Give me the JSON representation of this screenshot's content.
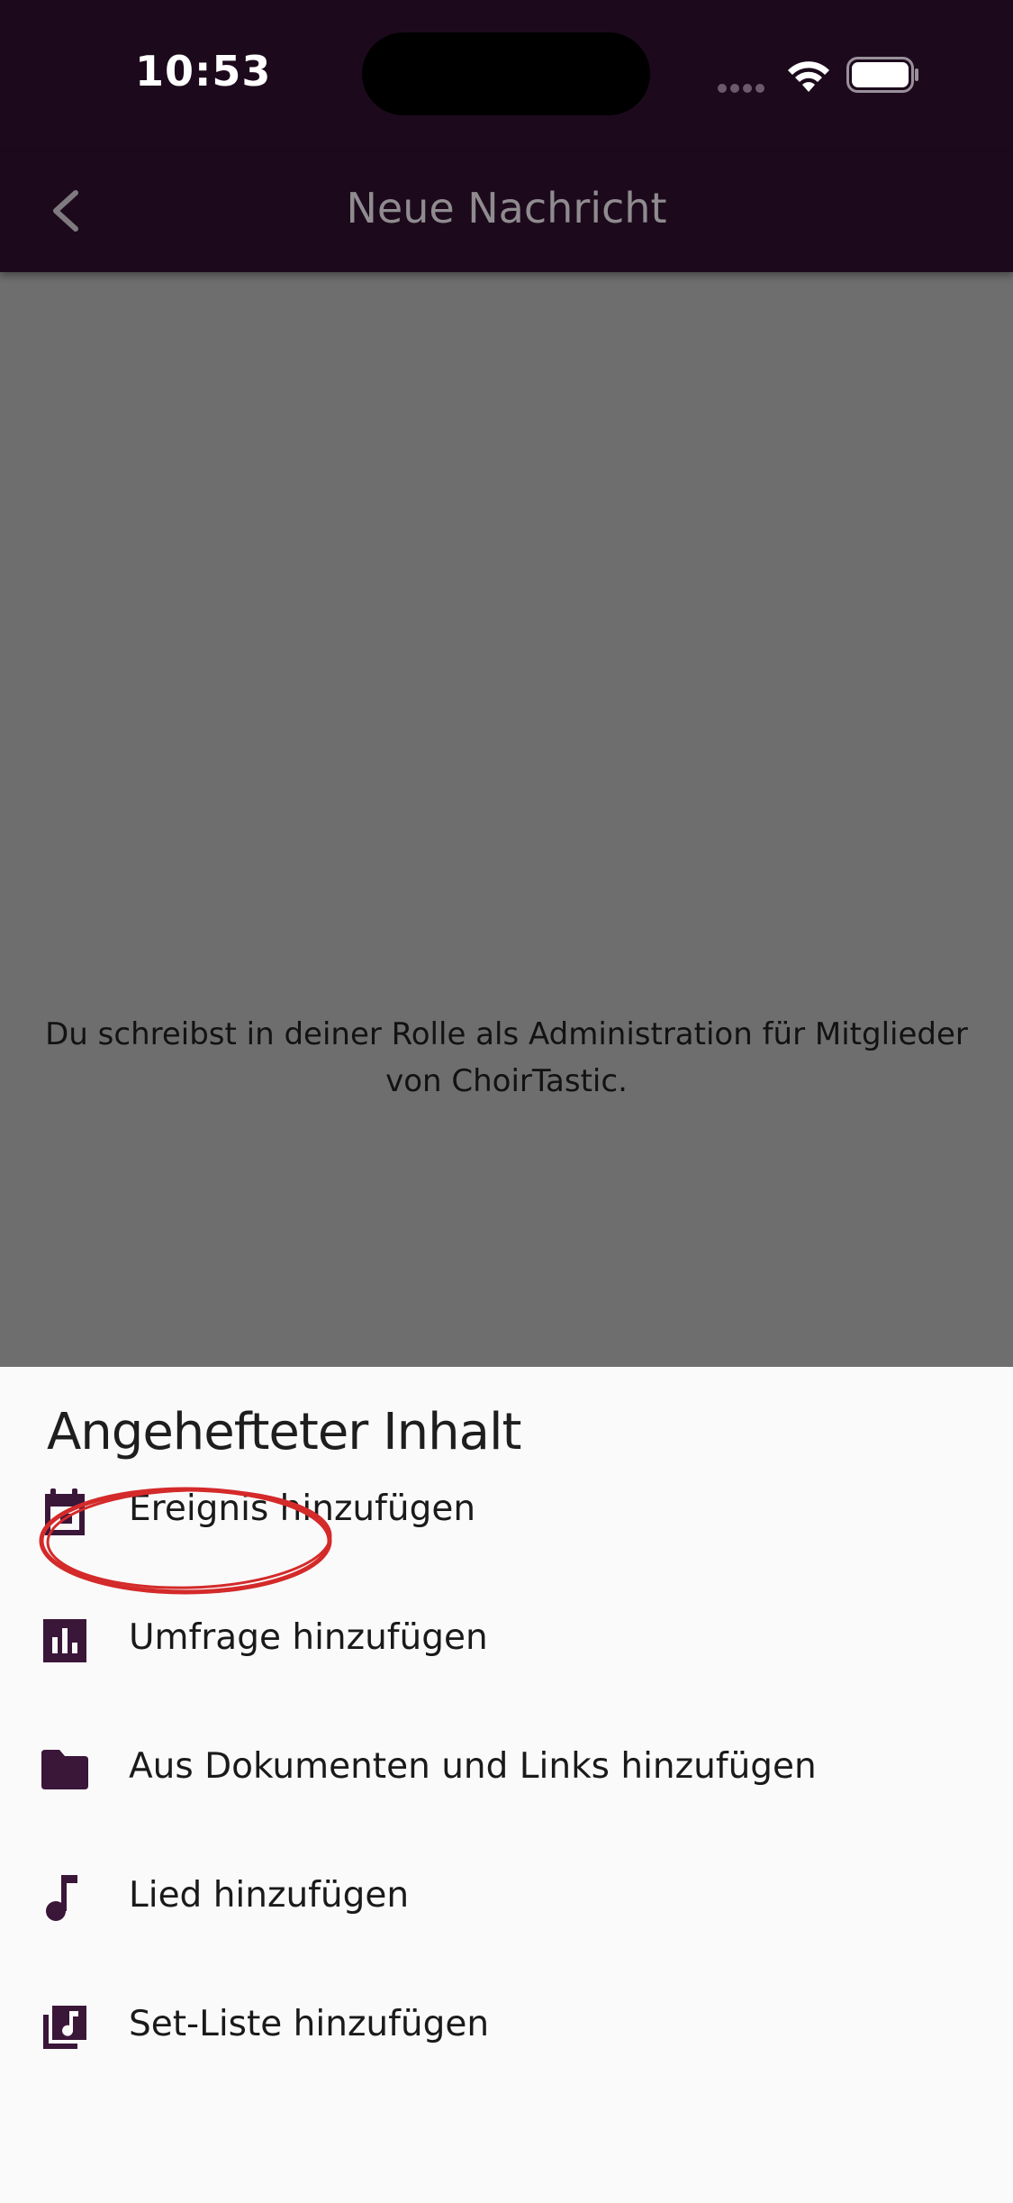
{
  "status_bar": {
    "time": "10:53"
  },
  "app_bar": {
    "title": "Neue Nachricht",
    "back_icon": "chevron-left-icon"
  },
  "compose": {
    "info_text": "Du schreibst in deiner Rolle als Administration für Mitglieder von ChoirTastic."
  },
  "sheet": {
    "title": "Angehefteter Inhalt",
    "options": [
      {
        "label": "Ereignis hinzufügen",
        "icon": "calendar-icon"
      },
      {
        "label": "Umfrage hinzufügen",
        "icon": "poll-icon"
      },
      {
        "label": "Aus Dokumenten und Links hinzufügen",
        "icon": "folder-icon"
      },
      {
        "label": "Lied hinzufügen",
        "icon": "music-note-icon"
      },
      {
        "label": "Set-Liste hinzufügen",
        "icon": "library-music-icon"
      }
    ]
  },
  "colors": {
    "app_bar_bg": "#1c0a1c",
    "scrim": "#6e6e6e",
    "sheet_bg": "#fafafa",
    "icon": "#3a1638",
    "annotation": "#d42a2a"
  }
}
